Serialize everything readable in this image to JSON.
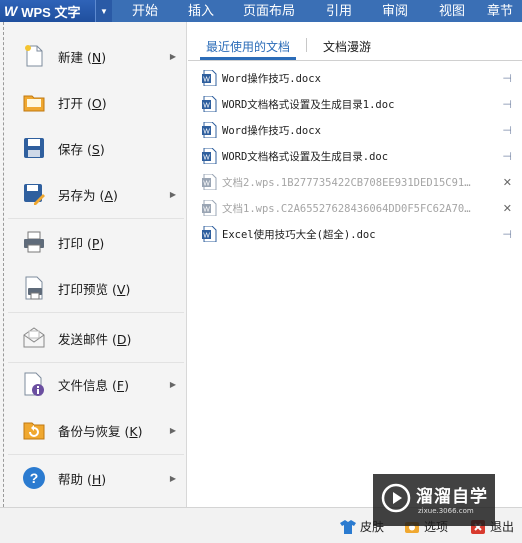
{
  "app": {
    "name": "WPS 文字"
  },
  "ribbon_tabs": [
    "开始",
    "插入",
    "页面布局",
    "引用",
    "审阅",
    "视图",
    "章节"
  ],
  "menu": [
    {
      "label": "新建",
      "key": "N",
      "arrow": true
    },
    {
      "label": "打开",
      "key": "O",
      "arrow": false
    },
    {
      "label": "保存",
      "key": "S",
      "arrow": false
    },
    {
      "label": "另存为",
      "key": "A",
      "arrow": true
    },
    {
      "label": "打印",
      "key": "P",
      "arrow": false
    },
    {
      "label": "打印预览",
      "key": "V",
      "arrow": false
    },
    {
      "label": "发送邮件",
      "key": "D",
      "arrow": false
    },
    {
      "label": "文件信息",
      "key": "F",
      "arrow": true
    },
    {
      "label": "备份与恢复",
      "key": "K",
      "arrow": true
    },
    {
      "label": "帮助",
      "key": "H",
      "arrow": true
    }
  ],
  "recent": {
    "tab_active": "最近使用的文档",
    "tab_other": "文档漫游",
    "files": [
      {
        "name": "Word操作技巧.docx",
        "enabled": true
      },
      {
        "name": "WORD文档格式设置及生成目录1.doc",
        "enabled": true
      },
      {
        "name": "Word操作技巧.docx",
        "enabled": true
      },
      {
        "name": "WORD文档格式设置及生成目录.doc",
        "enabled": true
      },
      {
        "name": "文档2.wps.1B277735422CB708EE931DED15C91…",
        "enabled": false
      },
      {
        "name": "文档1.wps.C2A65527628436064DD0F5FC62A70…",
        "enabled": false
      },
      {
        "name": "Excel使用技巧大全(超全).doc",
        "enabled": true
      }
    ]
  },
  "bottom": {
    "skin": "皮肤",
    "options": "选项",
    "exit": "退出"
  },
  "watermark": {
    "name": "溜溜自学",
    "url": "zixue.3066.com"
  },
  "colors": {
    "accent": "#2b6cb8",
    "titlebar": "#3a6fb5"
  }
}
